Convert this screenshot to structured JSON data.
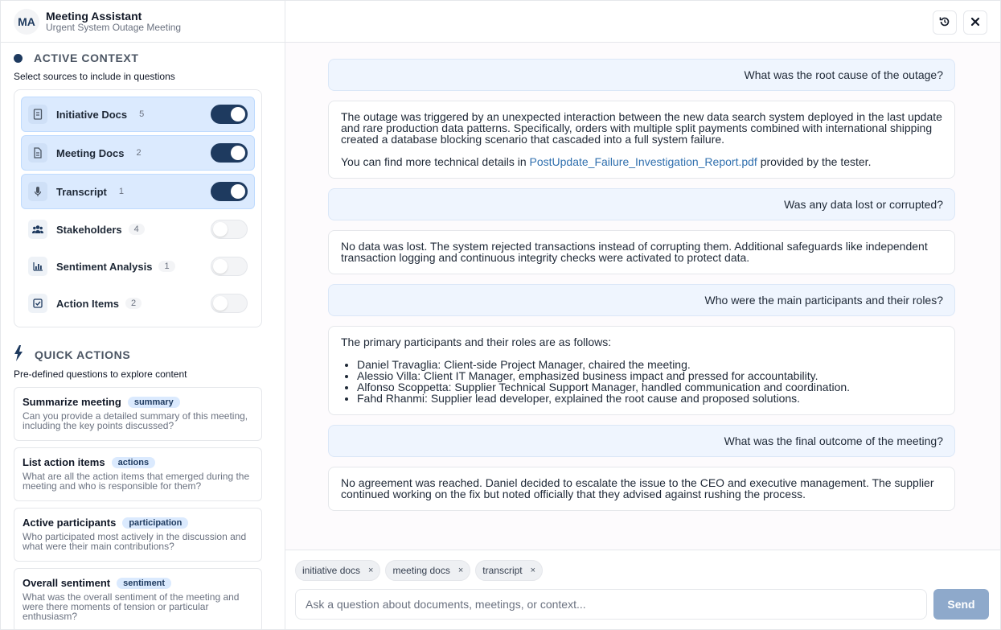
{
  "header": {
    "logo": "MA",
    "title": "Meeting Assistant",
    "subtitle": "Urgent System Outage Meeting"
  },
  "context": {
    "title": "ACTIVE CONTEXT",
    "description": "Select sources to include in questions",
    "sources": [
      {
        "label": "Initiative Docs",
        "count": "5",
        "enabled": true,
        "icon": "document-icon"
      },
      {
        "label": "Meeting Docs",
        "count": "2",
        "enabled": true,
        "icon": "file-text-icon"
      },
      {
        "label": "Transcript",
        "count": "1",
        "enabled": true,
        "icon": "microphone-icon"
      },
      {
        "label": "Stakeholders",
        "count": "4",
        "enabled": false,
        "icon": "users-icon"
      },
      {
        "label": "Sentiment Analysis",
        "count": "1",
        "enabled": false,
        "icon": "bar-chart-icon"
      },
      {
        "label": "Action Items",
        "count": "2",
        "enabled": false,
        "icon": "checkbox-icon"
      }
    ]
  },
  "quick_actions": {
    "title": "QUICK ACTIONS",
    "description": "Pre-defined questions to explore content",
    "items": [
      {
        "label": "Summarize meeting",
        "tag": "summary",
        "text": "Can you provide a detailed summary of this meeting, including the key points discussed?"
      },
      {
        "label": "List action items",
        "tag": "actions",
        "text": "What are all the action items that emerged during the meeting and who is responsible for them?"
      },
      {
        "label": "Active participants",
        "tag": "participation",
        "text": "Who participated most actively in the discussion and what were their main contributions?"
      },
      {
        "label": "Overall sentiment",
        "tag": "sentiment",
        "text": "What was the overall sentiment of the meeting and were there moments of tension or particular enthusiasm?"
      }
    ]
  },
  "chat": {
    "q1": "What was the root cause of the outage?",
    "a1_p1": "The outage was triggered by an unexpected interaction between the new data search system deployed in the last update and rare production data patterns. Specifically, orders with multiple split payments combined with international shipping created a database blocking scenario that cascaded into a full system failure.",
    "a1_p2_before": "You can find more technical details in ",
    "a1_link": "PostUpdate_Failure_Investigation_Report.pdf",
    "a1_p2_after": " provided by the tester.",
    "q2": "Was any data lost or corrupted?",
    "a2": "No data was lost. The system rejected transactions instead of corrupting them. Additional safeguards like independent transaction logging and continuous integrity checks were activated to protect data.",
    "q3": "Who were the main participants and their roles?",
    "a3_intro": "The primary participants and their roles are as follows:",
    "a3_list": [
      "Daniel Travaglia: Client-side Project Manager, chaired the meeting.",
      "Alessio Villa: Client IT Manager, emphasized business impact and pressed for accountability.",
      "Alfonso Scoppetta: Supplier Technical Support Manager, handled communication and coordination.",
      "Fahd Rhanmi: Supplier lead developer, explained the root cause and proposed solutions."
    ],
    "q4": "What was the final outcome of the meeting?",
    "a4": "No agreement was reached. Daniel decided to escalate the issue to the CEO and executive management. The supplier continued working on the fix but noted officially that they advised against rushing the process."
  },
  "composer": {
    "chips": [
      "initiative docs",
      "meeting docs",
      "transcript"
    ],
    "chip_remove": "×",
    "placeholder": "Ask a question about documents, meetings, or context...",
    "send_label": "Send"
  },
  "colors": {
    "accent": "#1e3a5f",
    "active_source_bg": "#dbeafe",
    "question_bg": "#eff5fe",
    "link": "#2f6fae",
    "send_button": "#8ea9cb"
  }
}
